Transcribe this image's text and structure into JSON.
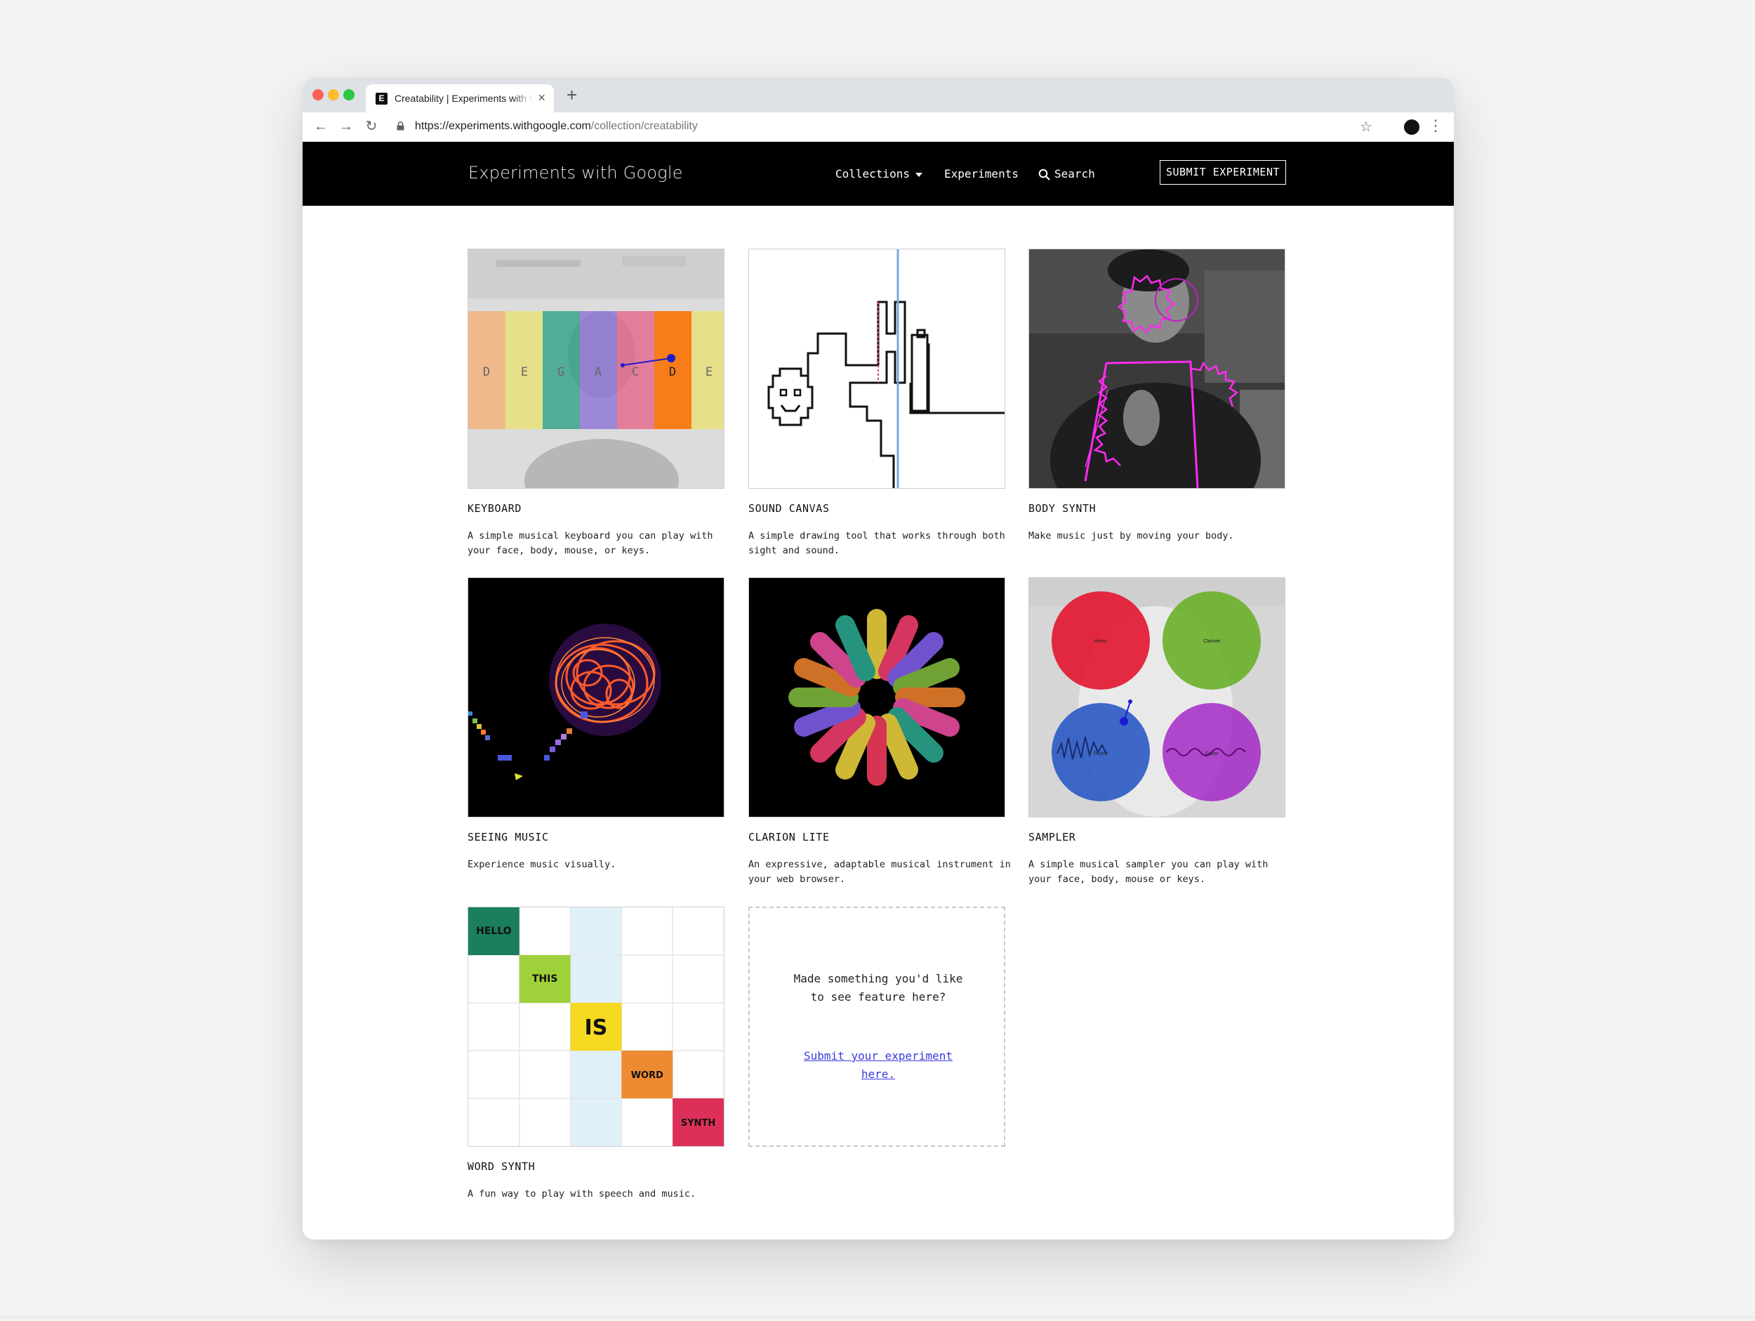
{
  "browser": {
    "tab_title": "Creatability | Experiments with Google",
    "favicon_letter": "E",
    "close_glyph": "×",
    "new_tab_glyph": "+",
    "url_host": "https://experiments.withgoogle.com",
    "url_path": "/collection/creatability",
    "back_glyph": "←",
    "forward_glyph": "→",
    "reload_glyph": "↻",
    "star_glyph": "☆",
    "menu_glyph": "⋮"
  },
  "header": {
    "brand": "Experiments with Google",
    "nav": {
      "collections": "Collections",
      "experiments": "Experiments",
      "search": "Search"
    },
    "submit_button": "SUBMIT EXPERIMENT"
  },
  "experiments": [
    {
      "title": "KEYBOARD",
      "description": "A simple musical keyboard you can play with your face, body, mouse, or keys.",
      "keys": [
        "D",
        "E",
        "G",
        "A",
        "C",
        "D",
        "E"
      ]
    },
    {
      "title": "SOUND CANVAS",
      "description": "A simple drawing tool that works through both sight and sound."
    },
    {
      "title": "BODY SYNTH",
      "description": "Make music just by moving your body."
    },
    {
      "title": "SEEING MUSIC",
      "description": "Experience music visually."
    },
    {
      "title": "CLARION LITE",
      "description": "An expressive, adaptable musical instrument in your web browser."
    },
    {
      "title": "SAMPLER",
      "description": "A simple musical sampler you can play with your face, body, mouse or keys.",
      "pads": [
        "Horns",
        "Clarinet",
        "Drums",
        "Guitar"
      ]
    },
    {
      "title": "WORD SYNTH",
      "description": "A fun way to play with speech and music.",
      "words": [
        "HELLO",
        "THIS",
        "IS",
        "WORD",
        "SYNTH"
      ]
    }
  ],
  "submit_card": {
    "question": "Made something you'd like to see feature here?",
    "link": "Submit your experiment here."
  },
  "colors": {
    "header_bg": "#000000",
    "link": "#3a3ae0",
    "accent_magenta": "#ff2bf0"
  }
}
